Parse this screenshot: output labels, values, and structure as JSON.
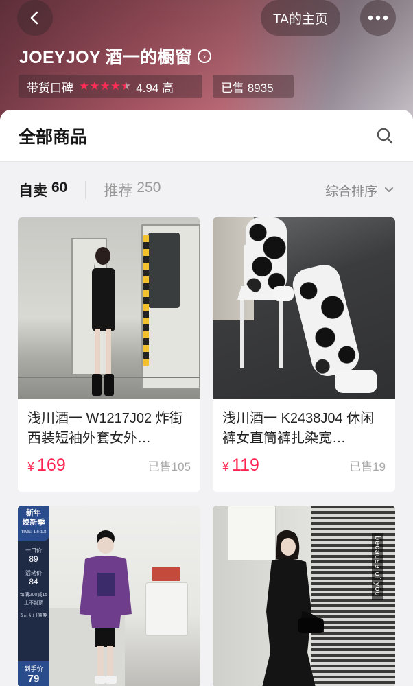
{
  "header": {
    "back_icon": "chevron-left-icon",
    "home_label": "TA的主页",
    "more_icon": "ellipsis-icon",
    "shop_name": "JOEYJOY 酒一的橱窗",
    "shop_chevron": "›",
    "reputation_label": "带货口碑",
    "rating_value": 4.5,
    "rating_text": "4.94 高",
    "sold_text": "已售 8935"
  },
  "sheet": {
    "title": "全部商品",
    "search_icon": "search-icon"
  },
  "tabs": [
    {
      "label": "自卖",
      "count": "60",
      "active": true
    },
    {
      "label": "推荐",
      "count": "250",
      "active": false
    }
  ],
  "sort": {
    "label": "综合排序",
    "icon": "chevron-down-icon"
  },
  "products": [
    {
      "title": "浅川酒一 W1217J02 炸街西装短袖外套女外…",
      "currency": "¥",
      "price": "169",
      "sold": "已售105"
    },
    {
      "title": "浅川酒一 K2438J04 休闲裤女直筒裤扎染宽…",
      "currency": "¥",
      "price": "119",
      "sold": "已售19"
    }
  ],
  "promo": {
    "title_line1": "新年",
    "title_line2": "焕新季",
    "subtitle": "TIME: 1.6-1.8",
    "price1_label": "一口价",
    "price1_value": "89",
    "price2_label": "活动价",
    "price2_value": "84",
    "note1": "每满200减15",
    "note2": "上不封顶",
    "note3": "5元无门槛券",
    "final_label": "到手价",
    "final_value": "79"
  },
  "blinds_text": "because of you"
}
